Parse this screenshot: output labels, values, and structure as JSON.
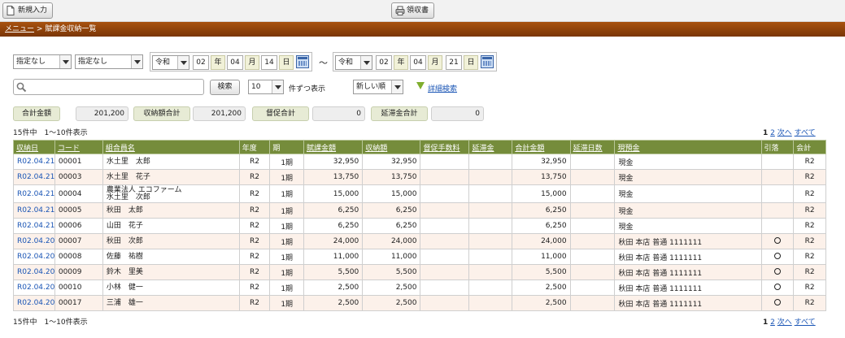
{
  "toolbar": {
    "new_label": "新規入力",
    "receipt_label": "領収書"
  },
  "breadcrumb": {
    "menu": "メニュー",
    "separator": ">",
    "current": "賦課金収納一覧"
  },
  "filters": {
    "filter1": "指定なし",
    "filter2": "指定なし",
    "from": {
      "era": "令和",
      "year": "02",
      "year_label": "年",
      "month": "04",
      "month_label": "月",
      "day": "14",
      "day_label": "日"
    },
    "tilde": "〜",
    "to": {
      "era": "令和",
      "year": "02",
      "year_label": "年",
      "month": "04",
      "month_label": "月",
      "day": "21",
      "day_label": "日"
    }
  },
  "search": {
    "value": "",
    "button": "検索",
    "per_page": "10",
    "per_page_suffix": "件ずつ表示",
    "sort": "新しい順",
    "advanced": "詳細検索"
  },
  "summary": [
    {
      "label": "合計金額",
      "value": "201,200"
    },
    {
      "label": "収納額合計",
      "value": "201,200"
    },
    {
      "label": "督促合計",
      "value": "0"
    },
    {
      "label": "延滞金合計",
      "value": "0"
    }
  ],
  "pager": {
    "info": "15件中　1〜10件表示",
    "current": "1",
    "next_page": "2",
    "next": "次へ",
    "all": "すべて"
  },
  "table": {
    "headers": [
      "収納日",
      "コード",
      "組合員名",
      "年度",
      "期",
      "賦課金額",
      "収納額",
      "督促手数料",
      "延滞金",
      "合計金額",
      "延滞日数",
      "現預金",
      "引落",
      "会計"
    ],
    "rows": [
      [
        "R02.04.21",
        "00001",
        "水土里　太郎",
        "R2",
        "1期",
        "32,950",
        "32,950",
        "",
        "",
        "32,950",
        "",
        "現金",
        "",
        "R2"
      ],
      [
        "R02.04.21",
        "00003",
        "水土里　花子",
        "R2",
        "1期",
        "13,750",
        "13,750",
        "",
        "",
        "13,750",
        "",
        "現金",
        "",
        "R2"
      ],
      [
        "R02.04.21",
        "00004",
        "農業法人 エコファーム\n水土里　次郎",
        "R2",
        "1期",
        "15,000",
        "15,000",
        "",
        "",
        "15,000",
        "",
        "現金",
        "",
        "R2"
      ],
      [
        "R02.04.21",
        "00005",
        "秋田　太郎",
        "R2",
        "1期",
        "6,250",
        "6,250",
        "",
        "",
        "6,250",
        "",
        "現金",
        "",
        "R2"
      ],
      [
        "R02.04.21",
        "00006",
        "山田　花子",
        "R2",
        "1期",
        "6,250",
        "6,250",
        "",
        "",
        "6,250",
        "",
        "現金",
        "",
        "R2"
      ],
      [
        "R02.04.20",
        "00007",
        "秋田　次郎",
        "R2",
        "1期",
        "24,000",
        "24,000",
        "",
        "",
        "24,000",
        "",
        "秋田 本店 普通 1111111",
        "○",
        "R2"
      ],
      [
        "R02.04.20",
        "00008",
        "佐藤　祐樹",
        "R2",
        "1期",
        "11,000",
        "11,000",
        "",
        "",
        "11,000",
        "",
        "秋田 本店 普通 1111111",
        "○",
        "R2"
      ],
      [
        "R02.04.20",
        "00009",
        "鈴木　里美",
        "R2",
        "1期",
        "5,500",
        "5,500",
        "",
        "",
        "5,500",
        "",
        "秋田 本店 普通 1111111",
        "○",
        "R2"
      ],
      [
        "R02.04.20",
        "00010",
        "小林　健一",
        "R2",
        "1期",
        "2,500",
        "2,500",
        "",
        "",
        "2,500",
        "",
        "秋田 本店 普通 1111111",
        "○",
        "R2"
      ],
      [
        "R02.04.20",
        "00017",
        "三浦　雄一",
        "R2",
        "1期",
        "2,500",
        "2,500",
        "",
        "",
        "2,500",
        "",
        "秋田 本店 普通 1111111",
        "○",
        "R2"
      ]
    ]
  }
}
